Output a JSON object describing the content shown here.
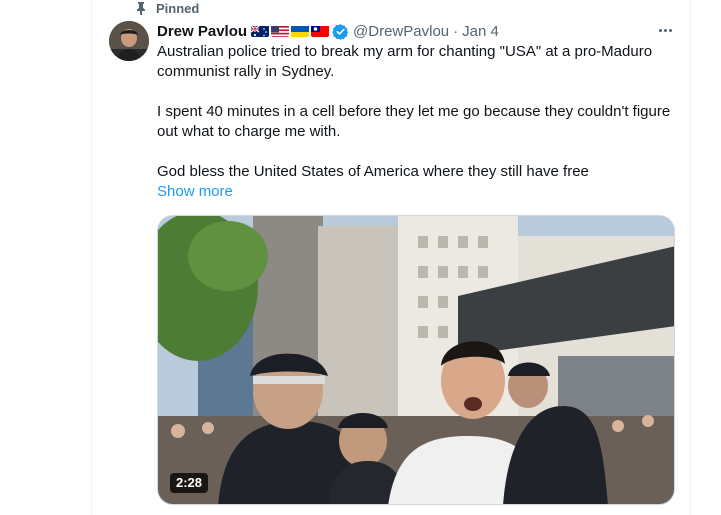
{
  "pinned": {
    "label": "Pinned"
  },
  "author": {
    "display_name": "Drew Pavlou",
    "flags": [
      "flag-australia",
      "flag-usa",
      "flag-ukraine",
      "flag-taiwan"
    ],
    "verified_icon": "verified-badge-icon",
    "handle": "@DrewPavlou",
    "separator": "·",
    "date": "Jan 4"
  },
  "tweet": {
    "lines": [
      "Australian police tried to break my arm for chanting \"USA\" at a pro-Maduro communist rally in Sydney.",
      "I spent 40 minutes in a cell before they let me go because they couldn't figure out what to charge me with.",
      "God bless the United States of America where they still have free"
    ],
    "show_more": "Show more"
  },
  "media": {
    "type": "video",
    "duration": "2:28"
  },
  "colors": {
    "accent": "#1d9bf0",
    "secondary_text": "#536471",
    "primary_text": "#0f1419",
    "border": "#cfd9de"
  }
}
